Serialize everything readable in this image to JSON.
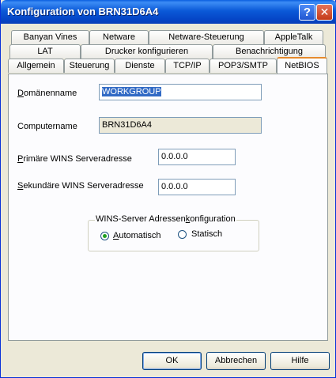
{
  "window": {
    "title": "Konfiguration von  BRN31D6A4"
  },
  "tabs": {
    "row1": [
      "Banyan Vines",
      "Netware",
      "Netware-Steuerung",
      "AppleTalk"
    ],
    "row2": [
      "LAT",
      "Drucker konfigurieren",
      "Benachrichtigung"
    ],
    "row3": [
      "Allgemein",
      "Steuerung",
      "Dienste",
      "TCP/IP",
      "POP3/SMTP",
      "NetBIOS"
    ],
    "active": "NetBIOS"
  },
  "form": {
    "domain_label_u": "D",
    "domain_label_rest": "omänenname",
    "domain_value": "WORKGROUP",
    "computer_label": "Computername",
    "computer_value": "BRN31D6A4",
    "wins_primary_label_u": "P",
    "wins_primary_label_rest": "rimäre WINS Serveradresse",
    "wins_primary_value": "0.0.0.0",
    "wins_secondary_label_u": "S",
    "wins_secondary_label_rest": "ekundäre WINS Serveradresse",
    "wins_secondary_value": "0.0.0.0"
  },
  "wins_group": {
    "title_a": "WINS-Server Adressen",
    "title_u": "k",
    "title_b": "onfiguration",
    "auto_u": "A",
    "auto_rest": "utomatisch",
    "static_label": "Statisch",
    "selected": "Automatisch"
  },
  "buttons": {
    "ok": "OK",
    "cancel": "Abbrechen",
    "help": "Hilfe"
  }
}
